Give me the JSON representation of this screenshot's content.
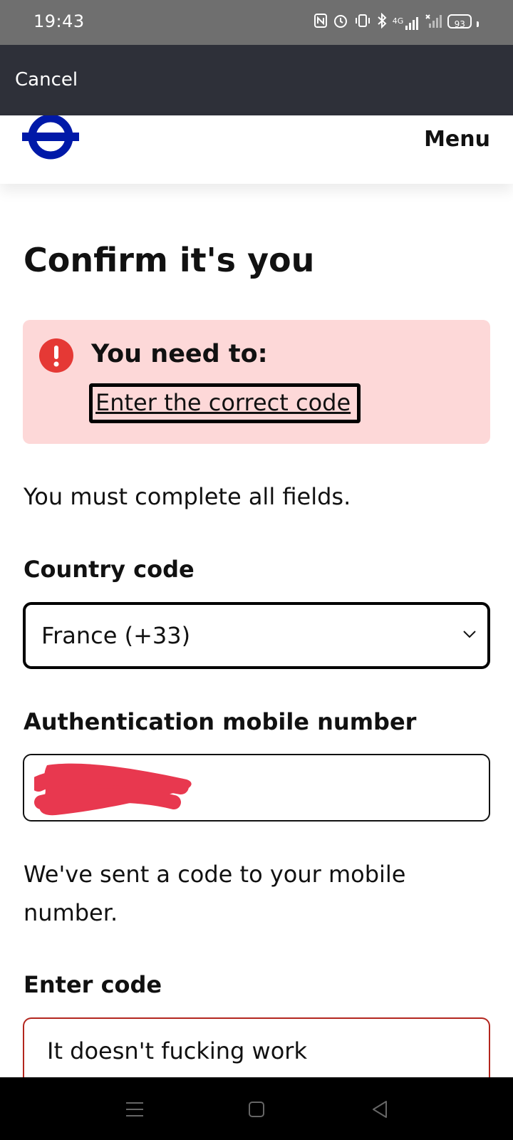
{
  "status_bar": {
    "time": "19:43",
    "network": "4G",
    "battery": "93",
    "icons": [
      "nfc-icon",
      "alarm-icon",
      "vibrate-icon",
      "bluetooth-icon",
      "signal-icon",
      "no-signal-icon",
      "battery-icon"
    ]
  },
  "top_nav": {
    "cancel_label": "Cancel"
  },
  "header": {
    "menu_label": "Menu",
    "logo_color": "#0019a8"
  },
  "page": {
    "title": "Confirm it's you",
    "error": {
      "heading": "You need to:",
      "link": "Enter the correct code",
      "icon_color": "#e53935",
      "background": "#fdd8d8"
    },
    "fields_note": "You must complete all fields.",
    "country": {
      "label": "Country code",
      "value": "France (+33)"
    },
    "mobile": {
      "label": "Authentication mobile number",
      "value": ""
    },
    "sent_note": "We've sent a code to your mobile number.",
    "code": {
      "label": "Enter code",
      "value": "It doesn't fucking work"
    }
  },
  "navigation_bar": {
    "buttons": [
      "menu-icon",
      "home-icon",
      "back-icon"
    ]
  }
}
